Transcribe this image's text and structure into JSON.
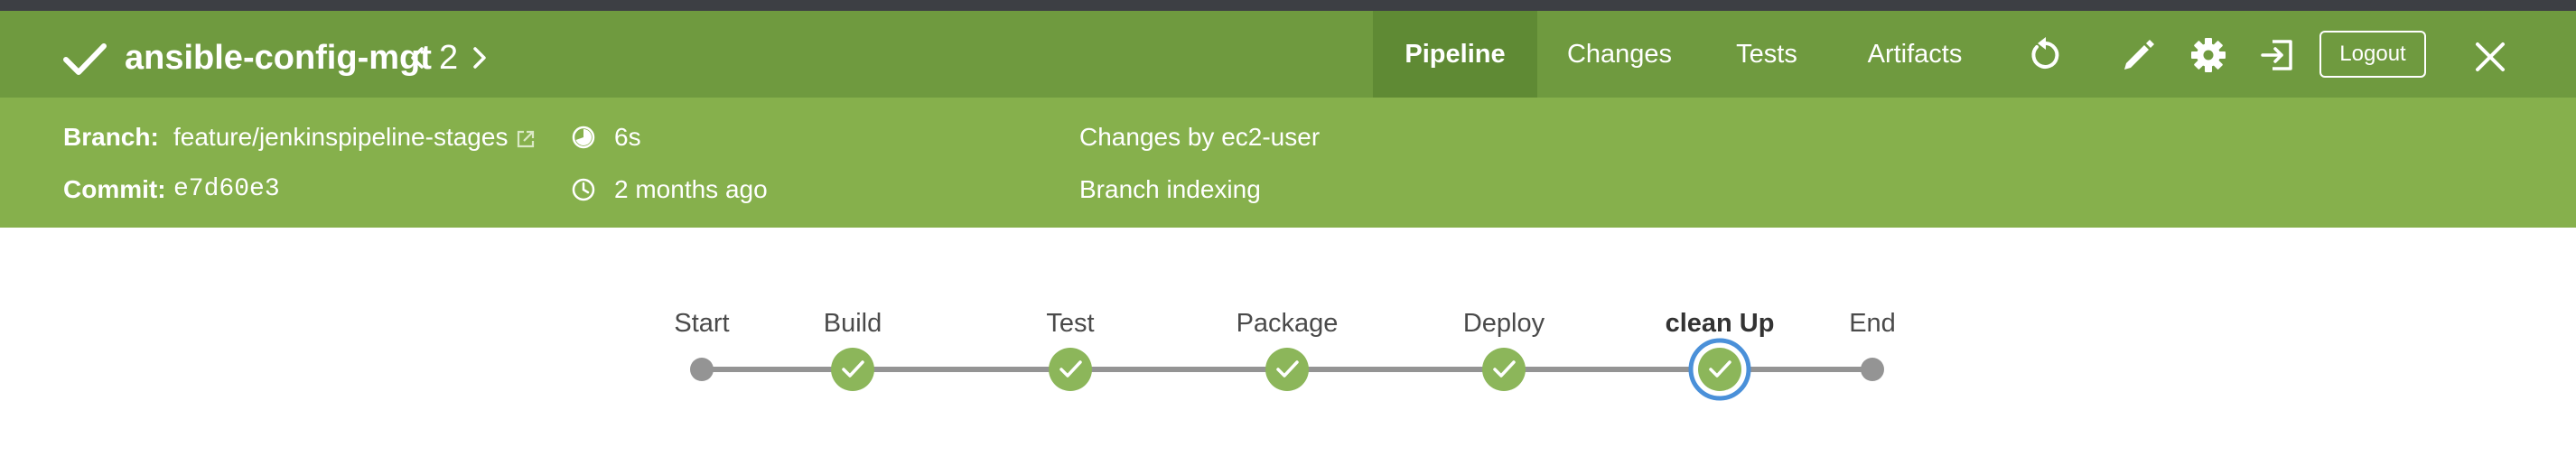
{
  "header": {
    "title": "ansible-config-mgt",
    "run_number": "2",
    "status_icon": "check-icon",
    "tabs": [
      {
        "label": "Pipeline",
        "active": true
      },
      {
        "label": "Changes",
        "active": false
      },
      {
        "label": "Tests",
        "active": false
      },
      {
        "label": "Artifacts",
        "active": false
      }
    ],
    "logout_label": "Logout",
    "icons": [
      "replay-icon",
      "edit-icon",
      "gear-icon",
      "open-classic-icon",
      "close-icon"
    ]
  },
  "details": {
    "branch_label": "Branch:",
    "branch_value": "feature/jenkinspipeline-stages",
    "commit_label": "Commit:",
    "commit_value": "e7d60e3",
    "duration": "6s",
    "time_ago": "2 months ago",
    "changes": "Changes by ec2-user",
    "cause": "Branch indexing"
  },
  "pipeline": {
    "stages": [
      {
        "label": "Start",
        "kind": "terminal",
        "selected": false
      },
      {
        "label": "Build",
        "kind": "success",
        "selected": false
      },
      {
        "label": "Test",
        "kind": "success",
        "selected": false
      },
      {
        "label": "Package",
        "kind": "success",
        "selected": false
      },
      {
        "label": "Deploy",
        "kind": "success",
        "selected": false
      },
      {
        "label": "clean Up",
        "kind": "success",
        "selected": true
      },
      {
        "label": "End",
        "kind": "terminal",
        "selected": false
      }
    ]
  },
  "colors": {
    "header_bg": "#6f9a3f",
    "details_bg": "#86b04c",
    "success": "#8cb65a",
    "selected_ring": "#4a90d9",
    "terminal": "#949494"
  }
}
